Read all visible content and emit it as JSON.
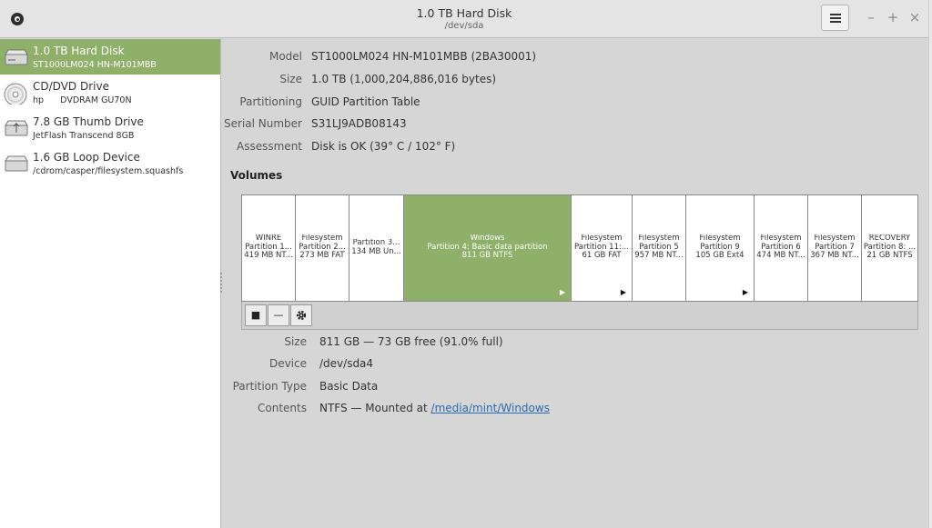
{
  "window": {
    "title": "1.0 TB Hard Disk",
    "subtitle": "/dev/sda",
    "menu_icon": "hamburger-menu-icon",
    "minimize": "–",
    "maximize": "+",
    "close": "×"
  },
  "sidebar": {
    "items": [
      {
        "name": "1.0 TB Hard Disk",
        "sub": "ST1000LM024 HN-M101MBB",
        "icon": "hard-disk-icon",
        "selected": true
      },
      {
        "name": "CD/DVD Drive",
        "sub": "hp      DVDRAM GU70N",
        "icon": "optical-disc-icon",
        "selected": false
      },
      {
        "name": "7.8 GB Thumb Drive",
        "sub": "JetFlash Transcend 8GB",
        "icon": "usb-drive-icon",
        "selected": false
      },
      {
        "name": "1.6 GB Loop Device",
        "sub": "/cdrom/casper/filesystem.squashfs",
        "icon": "loop-device-icon",
        "selected": false
      }
    ]
  },
  "disk_props": [
    {
      "label": "Model",
      "value": "ST1000LM024 HN-M101MBB (2BA30001)"
    },
    {
      "label": "Size",
      "value": "1.0 TB (1,000,204,886,016 bytes)"
    },
    {
      "label": "Partitioning",
      "value": "GUID Partition Table"
    },
    {
      "label": "Serial Number",
      "value": "S31LJ9ADB08143"
    },
    {
      "label": "Assessment",
      "value": "Disk is OK (39° C / 102° F)"
    }
  ],
  "volumes": {
    "heading": "Volumes",
    "partitions": [
      {
        "l1": "WINRE",
        "l2": "Partition 1...",
        "l3": "419 MB NT...",
        "arrow": false,
        "selected": false
      },
      {
        "l1": "Filesystem",
        "l2": "Partition 2...",
        "l3": "273 MB FAT",
        "arrow": false,
        "selected": false
      },
      {
        "l1": "",
        "l2": "Partition 3...",
        "l3": "134 MB Un...",
        "arrow": false,
        "selected": false
      },
      {
        "l1": "Windows",
        "l2": "Partition 4: Basic data partition",
        "l3": "811 GB NTFS",
        "arrow": true,
        "selected": true
      },
      {
        "l1": "Filesystem",
        "l2": "Partition 11:...",
        "l3": "61 GB FAT",
        "arrow": true,
        "selected": false
      },
      {
        "l1": "Filesystem",
        "l2": "Partition 5",
        "l3": "957 MB NT...",
        "arrow": false,
        "selected": false
      },
      {
        "l1": "Filesystem",
        "l2": "Partition 9",
        "l3": "105 GB Ext4",
        "arrow": true,
        "selected": false
      },
      {
        "l1": "Filesystem",
        "l2": "Partition 6",
        "l3": "474 MB NT...",
        "arrow": false,
        "selected": false
      },
      {
        "l1": "Filesystem",
        "l2": "Partition 7",
        "l3": "367 MB NT...",
        "arrow": false,
        "selected": false
      },
      {
        "l1": "RECOVERY",
        "l2": "Partition 8: ...",
        "l3": "21 GB NTFS",
        "arrow": false,
        "selected": false
      }
    ],
    "toolbar": {
      "stop": "■",
      "minus": "—",
      "gear_icon": "gear-icon"
    }
  },
  "partition_props": {
    "size_label": "Size",
    "size_value": "811 GB — 73 GB free (91.0% full)",
    "device_label": "Device",
    "device_value": "/dev/sda4",
    "type_label": "Partition Type",
    "type_value": "Basic Data",
    "contents_label": "Contents",
    "contents_prefix": "NTFS — Mounted at ",
    "contents_link": "/media/mint/Windows"
  },
  "colors": {
    "selection": "#8fb068",
    "link": "#2a6cb3"
  }
}
